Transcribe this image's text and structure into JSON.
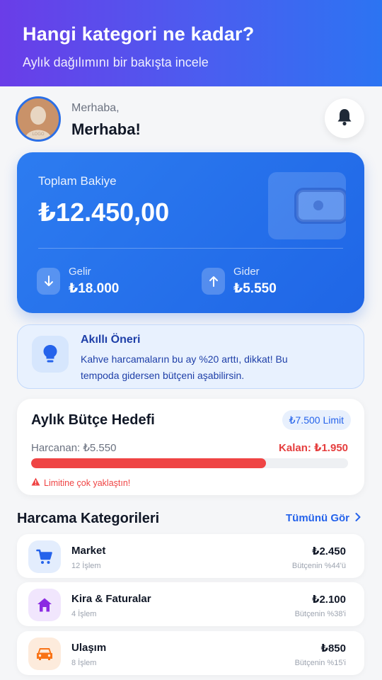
{
  "hero": {
    "title": "Hangi kategori ne kadar?",
    "subtitle": "Aylık dağılımını bir bakışta incele"
  },
  "greeting": {
    "small": "Merhaba,",
    "big": "Merhaba!"
  },
  "balance": {
    "label": "Toplam Bakiye",
    "amount": "₺12.450,00",
    "income_label": "Gelir",
    "income_value": "₺18.000",
    "expense_label": "Gider",
    "expense_value": "₺5.550"
  },
  "tip": {
    "title": "Akıllı Öneri",
    "text": "Kahve harcamaların bu ay %20 arttı, dikkat! Bu tempoda gidersen bütçeni aşabilirsin."
  },
  "budget": {
    "title": "Aylık Bütçe Hedefi",
    "limit": "₺7.500 Limit",
    "spent": "Harcanan: ₺5.550",
    "remaining": "Kalan: ₺1.950",
    "progress_fraction": 0.74,
    "warning": "Limitine çok yaklaştın!"
  },
  "categories_section": {
    "title": "Harcama Kategorileri",
    "see_all": "Tümünü Gör"
  },
  "categories": [
    {
      "name": "Market",
      "count": "12 İşlem",
      "amount": "₺2.450",
      "share": "Bütçenin %44'ü",
      "icon": "cart-icon",
      "color": "#2563eb",
      "bg": "#e3edfd"
    },
    {
      "name": "Kira & Faturalar",
      "count": "4 İşlem",
      "amount": "₺2.100",
      "share": "Bütçenin %38'i",
      "icon": "home-icon",
      "color": "#8b2be2",
      "bg": "#f1e6fd"
    },
    {
      "name": "Ulaşım",
      "count": "8 İşlem",
      "amount": "₺850",
      "share": "Bütçenin %15'i",
      "icon": "car-icon",
      "color": "#f97316",
      "bg": "#fdebdc"
    }
  ],
  "colors": {
    "accent": "#2563eb",
    "danger": "#ef4444",
    "hero_start": "#6a3de8",
    "hero_end": "#2c74f2"
  }
}
